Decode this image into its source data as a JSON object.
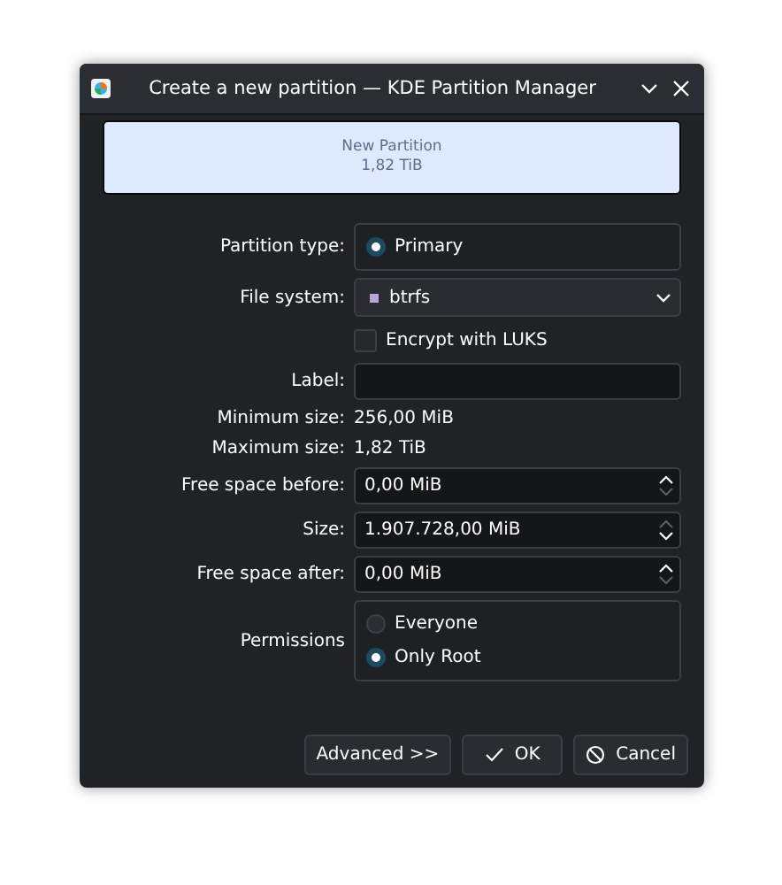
{
  "window": {
    "title": "Create a new partition — KDE Partition Manager"
  },
  "partition_bar": {
    "name": "New Partition",
    "size": "1,82 TiB"
  },
  "partition_type": {
    "label": "Partition type:",
    "options": [
      {
        "label": "Primary",
        "selected": true
      }
    ]
  },
  "file_system": {
    "label": "File system:",
    "value": "btrfs",
    "color": "#b9a6d6"
  },
  "encrypt": {
    "label": "Encrypt with LUKS",
    "checked": false
  },
  "label_field": {
    "label": "Label:"
  },
  "info": [
    {
      "label": "Minimum size:",
      "value": "256,00 MiB"
    },
    {
      "label": "Maximum size:",
      "value": "1,82 TiB"
    }
  ],
  "spinboxes": [
    {
      "label": "Free space before:",
      "value": "0,00 MiB",
      "can_increase": true,
      "can_decrease": false
    },
    {
      "label": "Size:",
      "value": "1.907.728,00 MiB",
      "can_increase": false,
      "can_decrease": true
    },
    {
      "label": "Free space after:",
      "value": "0,00 MiB",
      "can_increase": true,
      "can_decrease": false
    }
  ],
  "permissions": {
    "label": "Permissions",
    "options": [
      {
        "label": "Everyone",
        "selected": false
      },
      {
        "label": "Only Root",
        "selected": true
      }
    ]
  },
  "buttons": [
    {
      "label": "Advanced >>",
      "kind": "plain"
    },
    {
      "label": "OK",
      "kind": "accept"
    },
    {
      "label": "Cancel",
      "kind": "reject"
    }
  ]
}
